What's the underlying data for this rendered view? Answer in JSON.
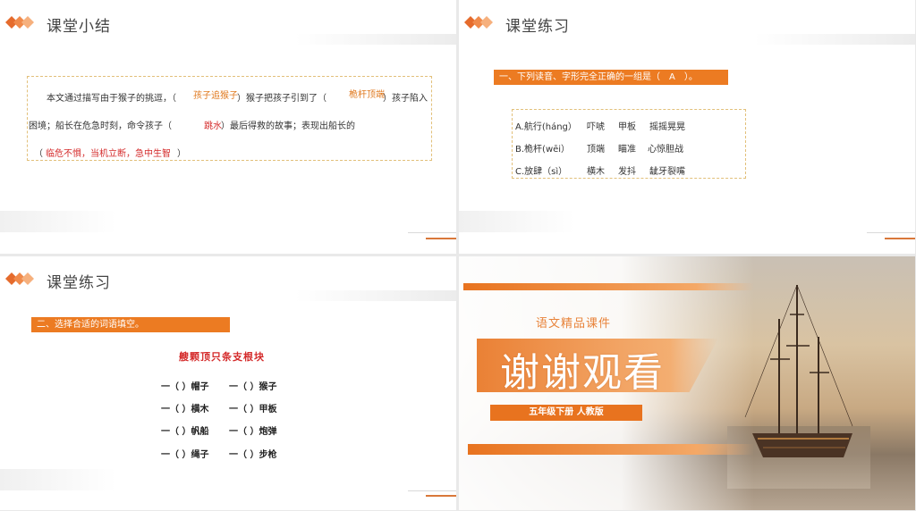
{
  "slide1": {
    "title": "课堂小结",
    "line1_a": "本文通过描写由于猴子的挑逗，（",
    "ans1": "孩子追猴子",
    "line1_b": "）猴子把孩子引到了（",
    "ans2": "桅杆顶端",
    "line1_c": "）孩子陷入",
    "line2_a": "困境；船长在危急时刻，命令孩子（",
    "ans3": "跳水",
    "line2_b": "）最后得救的故事；表现出船长的",
    "line3_a": "（",
    "ans4": "临危不惧，当机立断，急中生智",
    "line3_b": "）"
  },
  "slide2": {
    "title": "课堂练习",
    "question": "一、下列读音、字形完全正确的一组是（　A　）。",
    "options": [
      {
        "label": "A.航行(háng）",
        "w1": "吓唬",
        "w2": "甲板",
        "w3": "摇摇晃晃"
      },
      {
        "label": "B.桅杆(wēi）",
        "w1": "顶端",
        "w2": "瞄准",
        "w3": "心惊胆战"
      },
      {
        "label": "C.放肆（sì）",
        "w1": "横木",
        "w2": "发抖",
        "w3": "龇牙裂嘴"
      }
    ]
  },
  "slide3": {
    "title": "课堂练习",
    "question": "二、选择合适的词语填空。",
    "words": "艘颗顶只条支根块",
    "rows": [
      [
        "一（ ）帽子",
        "一（ ）猴子"
      ],
      [
        "一（ ）横木",
        "一（ ）甲板"
      ],
      [
        "一（ ）帆船",
        "一（ ）炮弹"
      ],
      [
        "一（ ）绳子",
        "一（ ）步枪"
      ]
    ]
  },
  "slide4": {
    "subtitle": "语文精品课件",
    "thanks": "谢谢观看",
    "grade": "五年级下册 人教版"
  },
  "colors": {
    "accent": "#ec7b22",
    "answer_orange": "#e07a20",
    "answer_red": "#d42a2a"
  }
}
